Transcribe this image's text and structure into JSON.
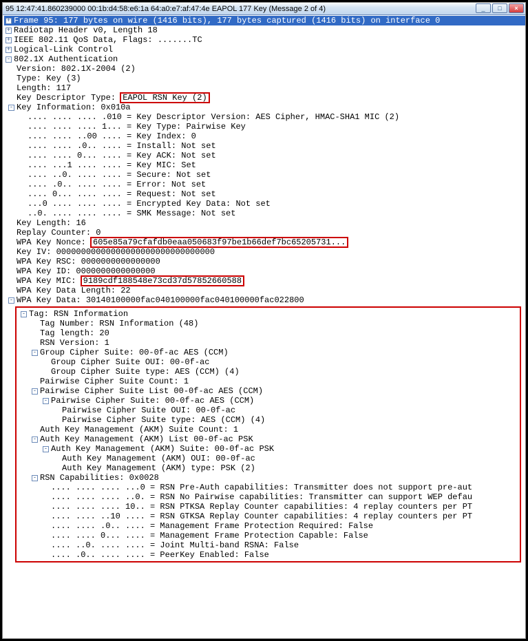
{
  "title": "95 12:47:41.860239000 00:1b:d4:58:e6:1a 64:a0:e7:af:47:4e EAPOL 177 Key (Message 2 of 4)",
  "windowControls": {
    "min": "_",
    "max": "□",
    "close": "×"
  },
  "frameLine": "Frame 95: 177 bytes on wire (1416 bits), 177 bytes captured (1416 bits) on interface 0",
  "radiotap": "Radiotap Header v0, Length 18",
  "ieee": "IEEE 802.11 QoS Data, Flags: .......TC",
  "llc": "Logical-Link Control",
  "auth": "802.1X Authentication",
  "authFields": {
    "version": "Version: 802.1X-2004 (2)",
    "type": "Type: Key (3)",
    "length": "Length: 117",
    "kdtLabel": "Key Descriptor Type: ",
    "kdtValue": "EAPOL RSN Key (2)",
    "keyInfo": "Key Information: 0x010a",
    "ki": [
      ".... .... .... .010 = Key Descriptor Version: AES Cipher, HMAC-SHA1 MIC (2)",
      ".... .... .... 1... = Key Type: Pairwise Key",
      ".... .... ..00 .... = Key Index: 0",
      ".... .... .0.. .... = Install: Not set",
      ".... .... 0... .... = Key ACK: Not set",
      ".... ...1 .... .... = Key MIC: Set",
      ".... ..0. .... .... = Secure: Not set",
      ".... .0.. .... .... = Error: Not set",
      ".... 0... .... .... = Request: Not set",
      "...0 .... .... .... = Encrypted Key Data: Not set",
      "..0. .... .... .... = SMK Message: Not set"
    ],
    "keyLength": "Key Length: 16",
    "replay": "Replay Counter: 0",
    "nonceLabel": "WPA Key Nonce: ",
    "nonceValue": "605e85a79cfafdb0eaa050683f97be1b66def7bc65205731...",
    "keyIV": "Key IV: 00000000000000000000000000000000",
    "keyRSC": "WPA Key RSC: 0000000000000000",
    "keyID": "WPA Key ID: 0000000000000000",
    "micLabel": "WPA Key MIC: ",
    "micValue": "9189cdf188548e73cd37d57852660588",
    "dataLen": "WPA Key Data Length: 22",
    "keyData": "WPA Key Data: 30140100000fac040100000fac040100000fac022800"
  },
  "rsn": {
    "tag": "Tag: RSN Information",
    "tagNum": "Tag Number: RSN Information (48)",
    "tagLen": "Tag length: 20",
    "rsnVer": "RSN Version: 1",
    "gcs": "Group Cipher Suite: 00-0f-ac AES (CCM)",
    "gcsOUI": "Group Cipher Suite OUI: 00-0f-ac",
    "gcsType": "Group Cipher Suite type: AES (CCM) (4)",
    "pcsCount": "Pairwise Cipher Suite Count: 1",
    "pcsList": "Pairwise Cipher Suite List 00-0f-ac AES (CCM)",
    "pcs": "Pairwise Cipher Suite: 00-0f-ac AES (CCM)",
    "pcsOUI": "Pairwise Cipher Suite OUI: 00-0f-ac",
    "pcsType": "Pairwise Cipher Suite type: AES (CCM) (4)",
    "akmCount": "Auth Key Management (AKM) Suite Count: 1",
    "akmList": "Auth Key Management (AKM) List 00-0f-ac PSK",
    "akm": "Auth Key Management (AKM) Suite: 00-0f-ac PSK",
    "akmOUI": "Auth Key Management (AKM) OUI: 00-0f-ac",
    "akmType": "Auth Key Management (AKM) type: PSK (2)",
    "cap": "RSN Capabilities: 0x0028",
    "caps": [
      ".... .... .... ...0 = RSN Pre-Auth capabilities: Transmitter does not support pre-aut",
      ".... .... .... ..0. = RSN No Pairwise capabilities: Transmitter can support WEP defau",
      ".... .... .... 10.. = RSN PTKSA Replay Counter capabilities: 4 replay counters per PT",
      ".... .... ..10 .... = RSN GTKSA Replay Counter capabilities: 4 replay counters per PT",
      ".... .... .0.. .... = Management Frame Protection Required: False",
      ".... .... 0... .... = Management Frame Protection Capable: False",
      ".... ..0. .... .... = Joint Multi-band RSNA: False",
      ".... .0.. .... .... = PeerKey Enabled: False"
    ]
  }
}
